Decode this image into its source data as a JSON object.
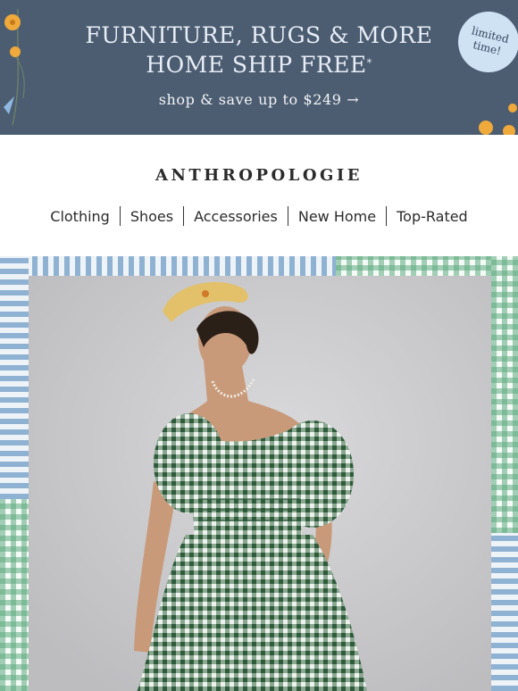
{
  "promo": {
    "headline_line1": "FURNITURE, RUGS & MORE",
    "headline_line2": "HOME SHIP FREE",
    "asterisk": "*",
    "subline": "shop & save up to $249 →",
    "badge_line1": "limited",
    "badge_line2": "time!",
    "colors": {
      "background": "#4c5d71",
      "badge": "#cfe2f4",
      "flowers": "#f0a93b"
    }
  },
  "header": {
    "brand": "ANTHROPOLOGIE",
    "nav": [
      "Clothing",
      "Shoes",
      "Accessories",
      "New Home",
      "Top-Rated"
    ]
  },
  "hero": {
    "colors": {
      "blue_stripe": "#8fb2d3",
      "green_gingham": "#5daa80",
      "backdrop": "#cfcfd1",
      "dress": "#4f7458"
    }
  }
}
